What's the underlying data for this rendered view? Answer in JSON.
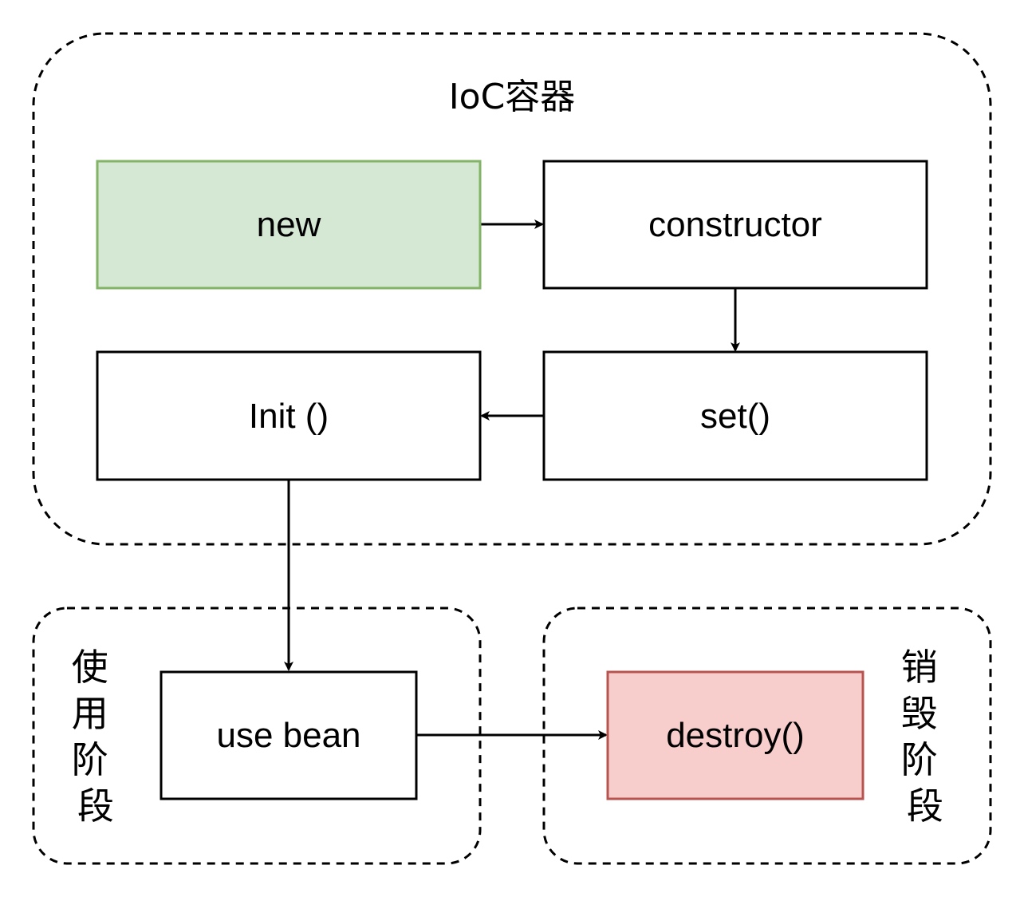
{
  "groups": {
    "ioc": {
      "label": "IoC容器"
    },
    "use_phase": {
      "label_chars": [
        "使",
        "用",
        "阶",
        "段"
      ]
    },
    "destroy_phase": {
      "label_chars": [
        "销",
        "毁",
        "阶",
        "段"
      ]
    }
  },
  "nodes": {
    "new": {
      "label": "new",
      "fill": "#d5e8d4",
      "stroke": "#82b366"
    },
    "constructor": {
      "label": "constructor",
      "fill": "#ffffff",
      "stroke": "#000000"
    },
    "set": {
      "label": "set()",
      "fill": "#ffffff",
      "stroke": "#000000"
    },
    "init": {
      "label": "Init ()",
      "fill": "#ffffff",
      "stroke": "#000000"
    },
    "use_bean": {
      "label": "use bean",
      "fill": "#ffffff",
      "stroke": "#000000"
    },
    "destroy": {
      "label": "destroy()",
      "fill": "#f8cecc",
      "stroke": "#b85450"
    }
  },
  "edges": [
    {
      "from": "new",
      "to": "constructor"
    },
    {
      "from": "constructor",
      "to": "set"
    },
    {
      "from": "set",
      "to": "init"
    },
    {
      "from": "init",
      "to": "use_bean"
    },
    {
      "from": "use_bean",
      "to": "destroy"
    }
  ]
}
